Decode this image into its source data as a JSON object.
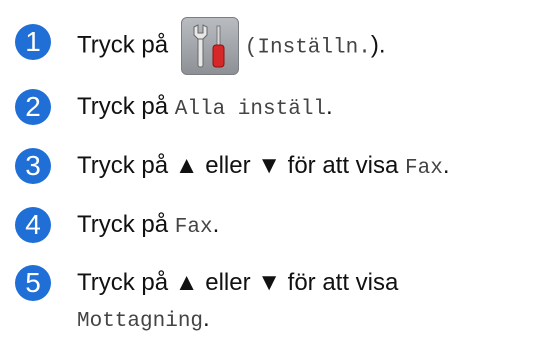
{
  "steps": [
    {
      "number": "1",
      "text_before": "Tryck på",
      "icon": "settings-tools-icon",
      "mono_text": "(Inställn.",
      "text_after": ")."
    },
    {
      "number": "2",
      "text_before": "Tryck på",
      "mono_text": "Alla inställ",
      "text_after": "."
    },
    {
      "number": "3",
      "text_before": "Tryck på ▲ eller ▼ för att visa",
      "mono_text": "Fax",
      "text_after": "."
    },
    {
      "number": "4",
      "text_before": "Tryck på",
      "mono_text": "Fax",
      "text_after": "."
    },
    {
      "number": "5",
      "text_before": "Tryck på ▲ eller ▼ för att visa",
      "mono_text": "Mottagning",
      "text_after": "."
    }
  ],
  "colors": {
    "step_badge": "#1f6fd6",
    "tool_button": "#9a9ea3"
  }
}
